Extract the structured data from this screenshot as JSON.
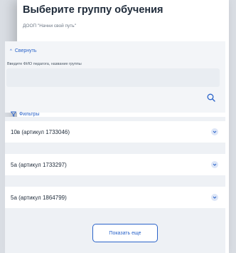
{
  "header": {
    "title": "Выберите группу обучения",
    "subtitle": "ДООП \"Начни свой путь\""
  },
  "filter": {
    "collapse_label": "Свернуть",
    "search_label": "Введите ФИО педагога, название группы",
    "search_value": "",
    "filters_label": "Фильтры"
  },
  "groups": [
    {
      "label": "10в (артикул 1733046)"
    },
    {
      "label": "5а (артикул 1733297)"
    },
    {
      "label": "5а (артикул 1864799)"
    }
  ],
  "show_more_label": "Показать еще",
  "colors": {
    "accent": "#2a63c9",
    "title": "#1f2b3a",
    "panel_bg": "#f3f5f8"
  }
}
